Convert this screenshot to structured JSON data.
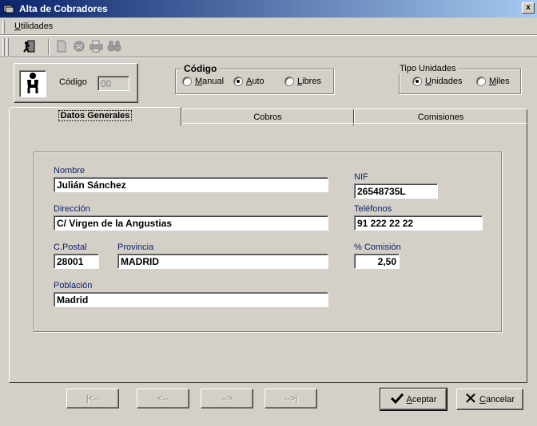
{
  "window": {
    "title": "Alta de Cobradores",
    "close_glyph": "x"
  },
  "menu": {
    "items": [
      {
        "label": "Utilidades"
      }
    ]
  },
  "toolbar": {
    "buttons": [
      "exit-door-icon",
      "document-icon",
      "globe-icon",
      "printer-icon",
      "binoculars-icon"
    ]
  },
  "header": {
    "codigo_label": "Código",
    "codigo_value": "00"
  },
  "codigo_group": {
    "legend": "Código",
    "options": [
      {
        "label": "Manual",
        "selected": false
      },
      {
        "label": "Auto",
        "selected": true
      },
      {
        "label": "Libres",
        "selected": false
      }
    ]
  },
  "units_group": {
    "legend": "Tipo Unidades",
    "options": [
      {
        "label": "Unidades",
        "selected": true
      },
      {
        "label": "Miles",
        "selected": false
      }
    ]
  },
  "tabs": [
    {
      "label": "Datos Generales",
      "active": true
    },
    {
      "label": "Cobros",
      "active": false
    },
    {
      "label": "Comisiones",
      "active": false
    }
  ],
  "form": {
    "nombre": {
      "label": "Nombre",
      "value": "Julián Sánchez"
    },
    "nif": {
      "label": "NIF",
      "value": "26548735L"
    },
    "direccion": {
      "label": "Dirección",
      "value": "C/ Virgen de la Angustias"
    },
    "telefonos": {
      "label": "Teléfonos",
      "value": "91 222 22 22"
    },
    "cpostal": {
      "label": "C.Postal",
      "value": "28001"
    },
    "provincia": {
      "label": "Provincia",
      "value": "MADRID"
    },
    "comision": {
      "label": "% Comisión",
      "value": "2,50"
    },
    "poblacion": {
      "label": "Población",
      "value": "Madrid"
    }
  },
  "nav": {
    "first": "|<--",
    "prev": "<--",
    "next": "-->",
    "last": "-->|"
  },
  "actions": {
    "accept": "Aceptar",
    "cancel": "Cancelar"
  },
  "colors": {
    "title_gradient_start": "#0a246a",
    "title_gradient_end": "#a6caf0",
    "face": "#d4d0c8",
    "caption_text": "#0a246a",
    "accept_check": "#008000"
  }
}
